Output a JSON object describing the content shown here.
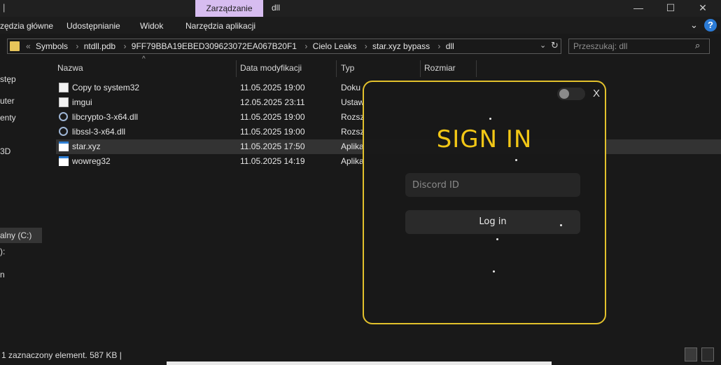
{
  "titlebar": {
    "pipe": "|",
    "manage_tab": "Zarządzanie",
    "title": "dll",
    "minimize_glyph": "—",
    "maximize_glyph": "☐",
    "close_glyph": "✕"
  },
  "ribbon": {
    "tabs": [
      "zędzia główne",
      "Udostępnianie",
      "Widok",
      "Narzędzia aplikacji"
    ],
    "expand_glyph": "⌄",
    "help_glyph": "?"
  },
  "address": {
    "prefix": "«",
    "crumbs": [
      "Symbols",
      "ntdll.pdb",
      "9FF79BBA19EBED309623072EA067B20F1",
      "Cielo Leaks",
      "star.xyz bypass",
      "dll"
    ],
    "separator": "›",
    "dropdown_glyph": "⌄",
    "refresh_glyph": "↻"
  },
  "search": {
    "placeholder": "Przeszukaj: dll",
    "icon_glyph": "⌕"
  },
  "sidebar": {
    "items": [
      "stęp",
      "uter",
      "enty",
      "3D",
      "alny (C:)",
      "):",
      "n"
    ]
  },
  "columns": {
    "name": "Nazwa",
    "date": "Data modyfikacji",
    "type": "Typ",
    "size": "Rozmiar",
    "sort_glyph": "^"
  },
  "files": [
    {
      "name": "Copy to system32",
      "date": "11.05.2025 19:00",
      "type": "Doku",
      "icon": "document-icon"
    },
    {
      "name": "imgui",
      "date": "12.05.2025 23:11",
      "type": "Ustaw",
      "icon": "settings-file-icon"
    },
    {
      "name": "libcrypto-3-x64.dll",
      "date": "11.05.2025 19:00",
      "type": "Rozsz",
      "icon": "dll-gear-icon"
    },
    {
      "name": "libssl-3-x64.dll",
      "date": "11.05.2025 19:00",
      "type": "Rozsz",
      "icon": "dll-gear-icon"
    },
    {
      "name": "star.xyz",
      "date": "11.05.2025 17:50",
      "type": "Aplika",
      "icon": "application-icon"
    },
    {
      "name": "wowreg32",
      "date": "11.05.2025 14:19",
      "type": "Aplika",
      "icon": "application-icon"
    }
  ],
  "login": {
    "close_glyph": "X",
    "title": "SIGN IN",
    "discord_placeholder": "Discord ID",
    "button_label": "Log in",
    "accent_color": "#e2c12c"
  },
  "status": {
    "text": "1 zaznaczony element. 587 KB  |"
  }
}
